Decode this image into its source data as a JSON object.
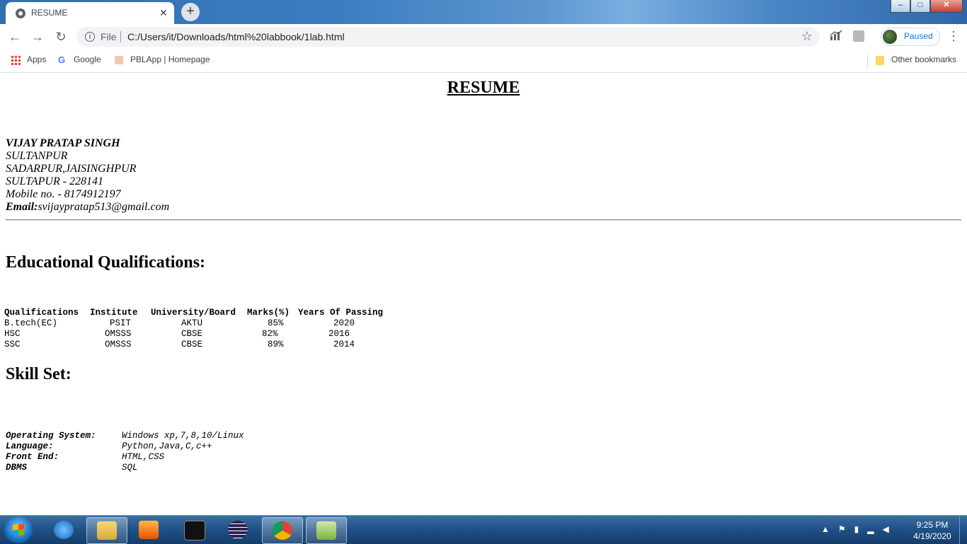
{
  "browser": {
    "tab": {
      "title": "RESUME",
      "close": "✕"
    },
    "new_tab": "+",
    "window_buttons": {
      "minimize": "–",
      "maximize": "□",
      "close": "✕"
    },
    "nav": {
      "back": "←",
      "forward": "→",
      "reload": "↻"
    },
    "omnibox": {
      "scheme": "File",
      "url": "C:/Users/it/Downloads/html%20labbook/1lab.html"
    },
    "star": "☆",
    "profile": {
      "status": "Paused"
    },
    "menu": "⋮",
    "bookmarks": {
      "apps": "Apps",
      "google": "Google",
      "pblapp": "PBLApp | Homepage",
      "other": "Other bookmarks"
    }
  },
  "page": {
    "title": "RESUME",
    "contact": {
      "name": "VIJAY PRATAP SINGH",
      "line1": "SULTANPUR",
      "line2": "SADARPUR,JAISINGHPUR",
      "line3": "SULTAPUR - 228141",
      "mobile": "Mobile no. - 8174912197",
      "email_label": "Email:",
      "email": "svijaypratap513@gmail.com"
    },
    "education": {
      "heading": "Educational Qualifications:",
      "headers": [
        "Qualifications",
        "Institute",
        "University/Board",
        "Marks(%)",
        "Years Of Passing"
      ],
      "rows": [
        [
          "B.tech(EC)",
          "PSIT",
          "AKTU",
          "85%",
          "2020"
        ],
        [
          "HSC",
          "OMSSS",
          "CBSE",
          "82%",
          "2016"
        ],
        [
          "SSC",
          "OMSSS",
          "CBSE",
          "89%",
          "2014"
        ]
      ]
    },
    "skills": {
      "heading": "Skill Set:",
      "items": [
        {
          "key": "Operating System:",
          "value": "Windows xp,7,8,10/Linux"
        },
        {
          "key": "Language:",
          "value": "Python,Java,C,c++"
        },
        {
          "key": "Front End:",
          "value": "HTML,CSS"
        },
        {
          "key": "DBMS",
          "value": "SQL"
        }
      ]
    }
  },
  "taskbar": {
    "apps": [
      "internet-explorer",
      "file-explorer",
      "media-player",
      "command-prompt",
      "eclipse",
      "chrome",
      "notepad-plus-plus"
    ],
    "clock": {
      "time": "9:25 PM",
      "date": "4/19/2020"
    }
  }
}
